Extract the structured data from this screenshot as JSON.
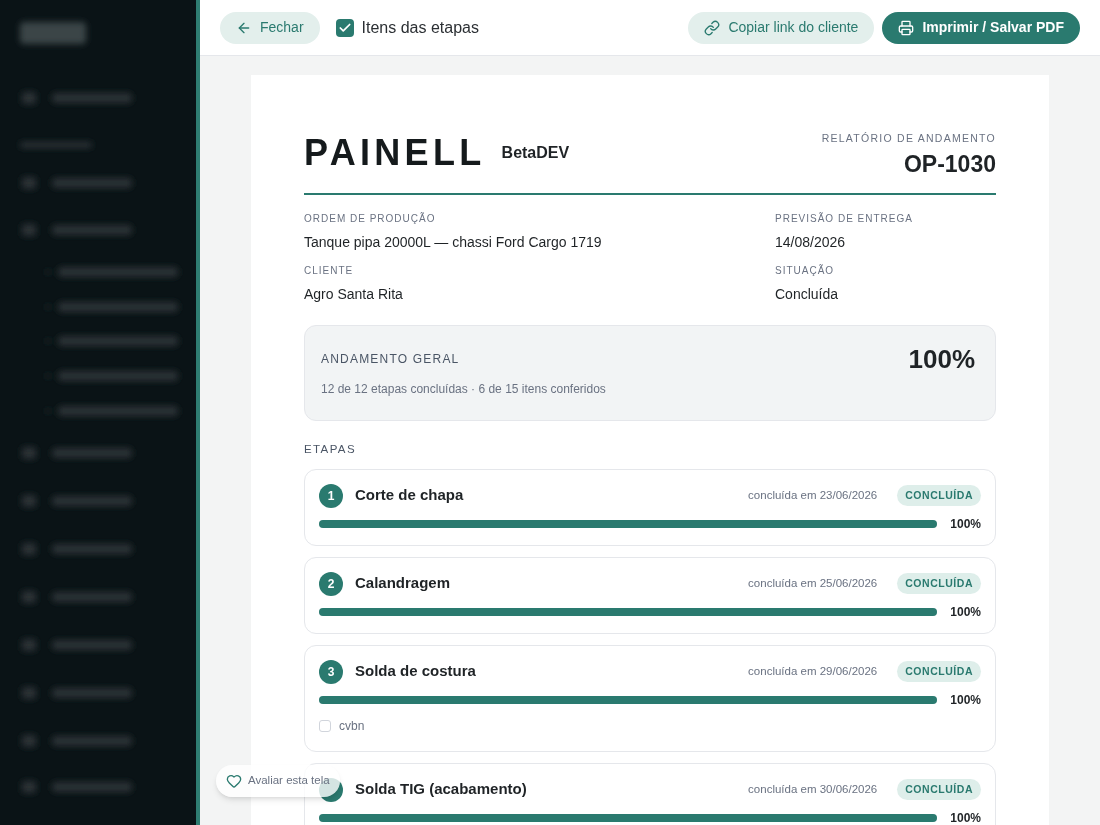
{
  "topbar": {
    "close_button": "Fechar",
    "steps_toggle": {
      "label": "Itens das etapas",
      "checked": true
    },
    "copy_link_button": "Copiar link do cliente",
    "print_button": "Imprimir / Salvar PDF"
  },
  "report": {
    "logo": "PAINELL",
    "company": "BetaDEV",
    "report_label": "RELATÓRIO DE ANDAMENTO",
    "order_code": "OP-1030",
    "fields": [
      {
        "label": "ORDEM DE PRODUÇÃO",
        "value": "Tanque pipa 20000L — chassi Ford Cargo 1719"
      },
      {
        "label": "PREVISÃO DE ENTREGA",
        "value": "14/08/2026"
      },
      {
        "label": "CLIENTE",
        "value": "Agro Santa Rita"
      },
      {
        "label": "SITUAÇÃO",
        "value": "Concluída"
      }
    ],
    "overall": {
      "label": "ANDAMENTO GERAL",
      "summary": "12 de 12 etapas concluídas · 6 de 15 itens conferidos",
      "percent": "100%"
    },
    "steps_heading": "ETAPAS",
    "steps": [
      {
        "number": "1",
        "name": "Corte de chapa",
        "date": "concluída em 23/06/2026",
        "status": "CONCLUÍDA",
        "level": 1,
        "percent": "100%"
      },
      {
        "number": "2",
        "name": "Calandragem",
        "date": "concluída em 25/06/2026",
        "status": "CONCLUÍDA",
        "level": 1,
        "percent": "100%"
      },
      {
        "number": "3",
        "name": "Solda de costura",
        "date": "concluída em 29/06/2026",
        "status": "CONCLUÍDA",
        "level": 1,
        "percent": "100%",
        "items": [
          {
            "label": "cvbn",
            "checked": false
          }
        ]
      },
      {
        "name": "Solda TIG (acabamento)",
        "date": "concluída em 30/06/2026",
        "status": "CONCLUÍDA",
        "level": 1,
        "percent": "100%"
      }
    ]
  },
  "feedback_button": "Avaliar esta tela"
}
